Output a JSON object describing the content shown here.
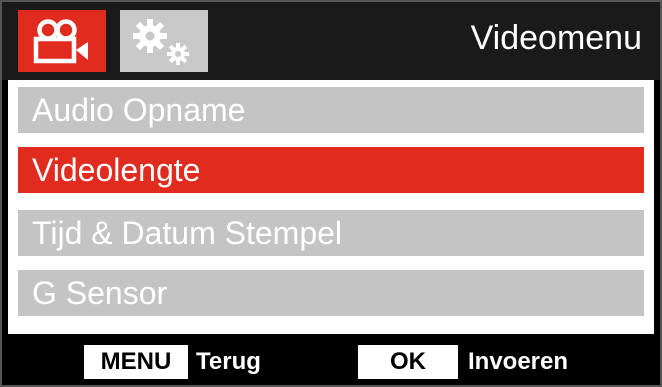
{
  "header": {
    "title": "Videomenu",
    "tabs": [
      {
        "icon": "video-camera-icon",
        "active": true
      },
      {
        "icon": "settings-gears-icon",
        "active": false
      }
    ]
  },
  "menu": {
    "items": [
      {
        "label": "Audio Opname",
        "selected": false
      },
      {
        "label": "Videolengte",
        "selected": true
      },
      {
        "label": "Tijd & Datum Stempel",
        "selected": false
      },
      {
        "label": "G Sensor",
        "selected": false
      }
    ]
  },
  "footer": {
    "menu_key": "MENU",
    "menu_action": "Terug",
    "ok_key": "OK",
    "ok_action": "Invoeren"
  },
  "colors": {
    "accent": "#e02b1e",
    "item_bg": "#c4c4c4",
    "background": "#000000"
  }
}
